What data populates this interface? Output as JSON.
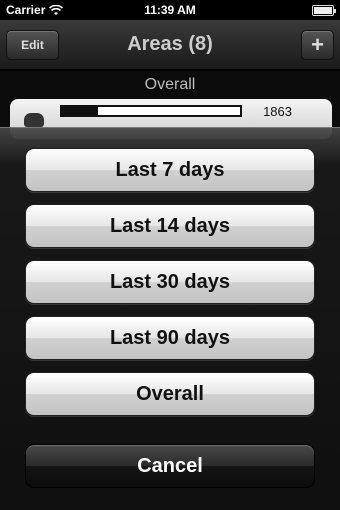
{
  "status_bar": {
    "carrier": "Carrier",
    "time": "11:39 AM"
  },
  "nav": {
    "edit_label": "Edit",
    "title": "Areas (8)",
    "add_label": "+"
  },
  "content": {
    "section_title": "Overall",
    "rows": [
      {
        "value": "1863",
        "progress": 0.2
      }
    ]
  },
  "sheet": {
    "options": [
      "Last 7 days",
      "Last 14 days",
      "Last 30 days",
      "Last 90 days",
      "Overall"
    ],
    "cancel_label": "Cancel"
  }
}
